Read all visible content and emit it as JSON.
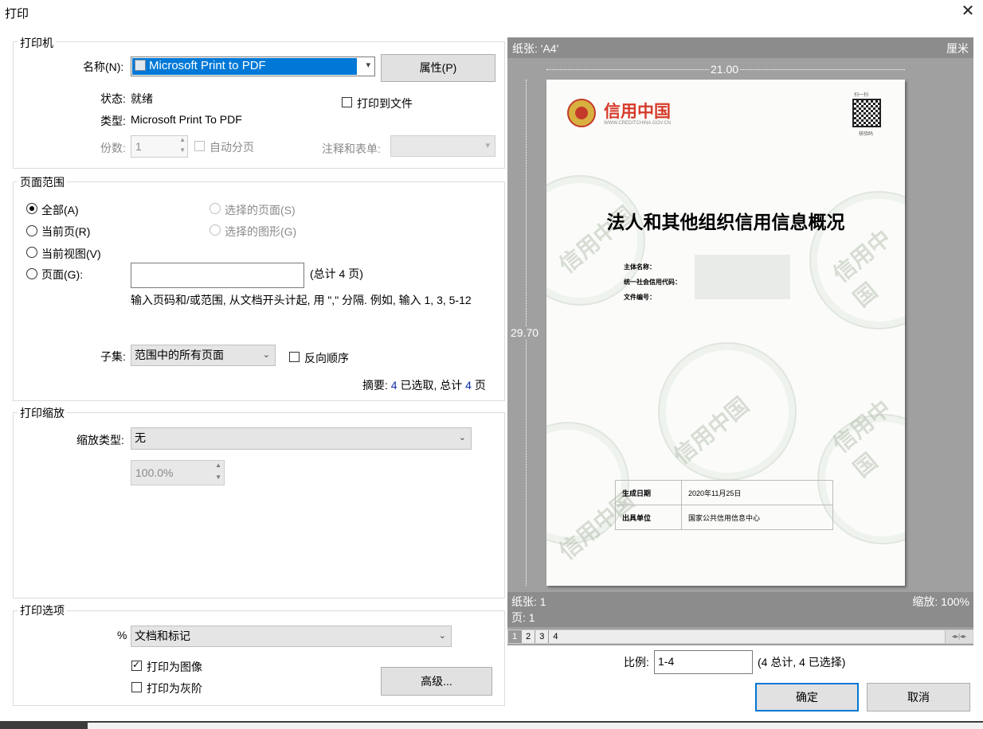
{
  "dialog": {
    "title": "打印"
  },
  "printer": {
    "group_label": "打印机",
    "name_label": "名称(N):",
    "name_value": "Microsoft Print to PDF",
    "properties_button": "属性(P)",
    "status_label": "状态:",
    "status_value": "就绪",
    "type_label": "类型:",
    "type_value": "Microsoft Print To PDF",
    "print_to_file": "打印到文件",
    "copies_label": "份数:",
    "copies_value": "1",
    "collate": "自动分页",
    "comments_label": "注释和表单:"
  },
  "range": {
    "group_label": "页面范围",
    "all": "全部(A)",
    "current_page": "当前页(R)",
    "current_view": "当前视图(V)",
    "pages": "页面(G):",
    "selected_pages": "选择的页面(S)",
    "selected_graphic": "选择的图形(G)",
    "pages_total": "(总计 4 页)",
    "hint": "输入页码和/或范围, 从文档开头计起, 用 \",\" 分隔. 例如, 输入 1, 3, 5-12",
    "subset_label": "子集:",
    "subset_value": "范围中的所有页面",
    "reverse": "反向顺序",
    "summary_prefix": "摘要:",
    "summary_selected_count": "4",
    "summary_selected_text": "已选取, 总计",
    "summary_total": "4",
    "summary_suffix": "页"
  },
  "scaling": {
    "group_label": "打印缩放",
    "type_label": "缩放类型:",
    "type_value": "无",
    "percent_value": "100.0%"
  },
  "options": {
    "group_label": "打印选项",
    "percent_label": "%",
    "content_value": "文档和标记",
    "print_as_image": "打印为图像",
    "print_grayscale": "打印为灰阶",
    "advanced_button": "高级..."
  },
  "preview": {
    "paper_label": "纸张: 'A4'",
    "unit": "厘米",
    "width_dim": "21.00",
    "height_dim": "29.70",
    "sheets": "纸张: 1",
    "pages": "页: 1",
    "zoom": "缩放: 100%",
    "tabs": [
      "1",
      "2",
      "3",
      "4"
    ],
    "doc": {
      "brand": "信用中国",
      "brand_url": "WWW.CREDITCHINA.GOV.CN",
      "qr_top": "扫一扫",
      "qr_bottom": "核验码",
      "title": "法人和其他组织信用信息概况",
      "field1": "主体名称：",
      "field2": "统一社会信用代码：",
      "field3": "文件编号：",
      "row1_label": "生成日期",
      "row1_value": "2020年11月25日",
      "row2_label": "出具单位",
      "row2_value": "国家公共信用信息中心",
      "watermark": "信用中国"
    }
  },
  "footer": {
    "ratio_label": "比例:",
    "ratio_value": "1-4",
    "ratio_note": "(4 总计, 4 已选择)",
    "ok_button": "确定",
    "cancel_button": "取消"
  },
  "colors": {
    "accent": "#0078d7",
    "selected_bg": "#0078d7",
    "link_blue": "#0a2aa5",
    "brand_red": "#d63a2a"
  }
}
